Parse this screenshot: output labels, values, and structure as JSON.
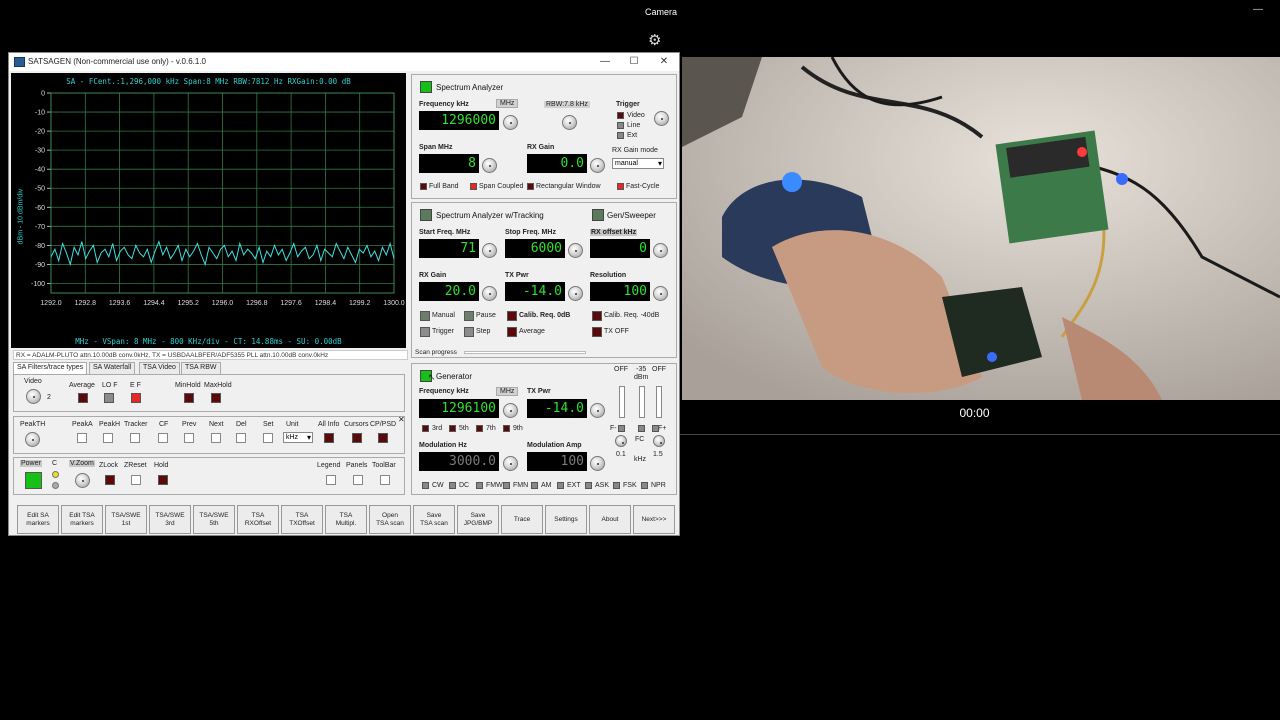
{
  "camera": {
    "title": "Camera",
    "minimize": "—",
    "time": "00:00"
  },
  "window": {
    "title": "SATSAGEN (Non-commercial use only) - v.0.6.1.0",
    "min": "—",
    "max": "☐",
    "close": "✕"
  },
  "plot": {
    "header": "SA - FCent.:1,296,000 kHz Span:8 MHz RBW:7812 Hz RXGain:0.00 dB",
    "footer": "MHz - VSpan: 8 MHz - 800 KHz/div - CT: 14.88ms - SU: 0.00dB",
    "ylabel": "dBm - 10 dBm/div"
  },
  "chart_data": {
    "type": "line",
    "title": "SA - FCent.:1,296,000 kHz Span:8 MHz RBW:7812 Hz RXGain:0.00 dB",
    "xlabel": "MHz - VSpan: 8 MHz - 800 KHz/div - CT: 14.88ms - SU: 0.00dB",
    "ylabel": "dBm - 10 dBm/div",
    "xlim": [
      1292.0,
      1300.0
    ],
    "ylim": [
      -105,
      0
    ],
    "grid": true,
    "x_ticks": [
      "1292.0",
      "1292.8",
      "1293.6",
      "1294.4",
      "1295.2",
      "1296.0",
      "1296.8",
      "1297.6",
      "1298.4",
      "1299.2",
      "1300.0"
    ],
    "y_ticks": [
      "0",
      "-10",
      "-20",
      "-30",
      "-40",
      "-50",
      "-60",
      "-70",
      "-80",
      "-90",
      "-100"
    ],
    "series": [
      {
        "values": [
          -86,
          -82,
          -88,
          -79,
          -84,
          -90,
          -81,
          -85,
          -78,
          -87,
          -83,
          -80,
          -89,
          -84,
          -82,
          -86,
          -79,
          -88,
          -83,
          -81,
          -85,
          -87,
          -80,
          -84,
          -86,
          -82,
          -89,
          -83,
          -78,
          -85,
          -81,
          -87,
          -84,
          -80,
          -88,
          -82,
          -86,
          -83,
          -79,
          -85,
          -90,
          -81,
          -84,
          -87,
          -82,
          -80,
          -86,
          -83,
          -88,
          -79,
          -85,
          -82,
          -84,
          -87,
          -81,
          -89,
          -83,
          -86,
          -80,
          -85,
          -82,
          -88,
          -84,
          -79,
          -86,
          -83,
          -81,
          -87,
          -85,
          -80,
          -88,
          -82,
          -84,
          -86,
          -79,
          -83,
          -87,
          -81,
          -85,
          -89,
          -82,
          -84,
          -80,
          -86,
          -83,
          -88,
          -81,
          -85,
          -79,
          -87
        ]
      }
    ]
  },
  "status_line": "RX = ADALM-PLUTO attn.10.00dB conv.0kHz, TX = USBDAALBFER/ADF5355 PLL attn.10.00dB conv.0kHz",
  "tabs": [
    "SA Filters/trace types",
    "SA Waterfall",
    "TSA Video",
    "TSA RBW"
  ],
  "filters": {
    "video": "Video",
    "video_val": "2",
    "average": "Average",
    "lof": "LO F",
    "ef": "E F",
    "minhold": "MinHold",
    "maxhold": "MaxHold"
  },
  "peaks": {
    "peakth": "PeakTH",
    "peaka": "PeakA",
    "peakh": "PeakH",
    "tracker": "Tracker",
    "cf": "CF",
    "prev": "Prev",
    "next": "Next",
    "del": "Del",
    "set": "Set",
    "unit": "Unit",
    "unit_val": "kHz",
    "allinfo": "All Info",
    "cursors": "Cursors",
    "cpsd": "CP/PSD",
    "close": "✕"
  },
  "power": {
    "power": "Power",
    "c": "C",
    "vzoom": "V.Zoom",
    "zlock": "ZLock",
    "zreset": "ZReset",
    "hold": "Hold",
    "legend": "Legend",
    "panels": "Panels",
    "toolbar": "ToolBar"
  },
  "sa": {
    "title": "Spectrum Analyzer",
    "freq_label": "Frequency kHz",
    "mhz": "MHz",
    "freq": "1296000",
    "rbw": "RBW:7.8 kHz",
    "trigger": "Trigger",
    "trig_video": "Video",
    "trig_line": "Line",
    "trig_ext": "Ext",
    "span_label": "Span MHz",
    "span": "8",
    "gain_label": "RX Gain",
    "gain": "0.0",
    "mode_label": "RX Gain mode",
    "mode": "manual",
    "fullband": "Full Band",
    "spancoupled": "Span Coupled",
    "rectwin": "Rectangular Window",
    "fastcycle": "Fast-Cycle"
  },
  "tsa": {
    "title": "Spectrum Analyzer w/Tracking",
    "gen_title": "Gen/Sweeper",
    "start_label": "Start Freq. MHz",
    "start": "71",
    "stop_label": "Stop Freq. MHz",
    "stop": "6000",
    "rxoff_label": "RX offset kHz",
    "rxoff": "0",
    "rxgain_label": "RX Gain",
    "rxgain": "20.0",
    "txpwr_label": "TX Pwr",
    "txpwr": "-14.0",
    "res_label": "Resolution",
    "res": "100",
    "manual": "Manual",
    "pause": "Pause",
    "calib0": "Calib. Req. 0dB",
    "calib40": "Calib. Req. -40dB",
    "trigger": "Trigger",
    "step": "Step",
    "average": "Average",
    "txoff": "TX OFF",
    "scan": "Scan progress"
  },
  "gen": {
    "title": "Generator",
    "freq_label": "Frequency kHz",
    "mhz": "MHz",
    "freq": "1296100",
    "txpwr_label": "TX Pwr",
    "txpwr": "-14.0",
    "h3": "3rd",
    "h5": "5th",
    "h7": "7th",
    "h9": "9th",
    "mod_label": "Modulation Hz",
    "mod": "3000.0",
    "amp_label": "Modulation Amp",
    "amp": "100",
    "off1": "OFF",
    "dbm": "-35\ndBm",
    "off2": "OFF",
    "fminus": "F-",
    "fc": "FC",
    "fplus": "F+",
    "v01": "0.1",
    "khz": "kHz",
    "v15": "1.5",
    "cw": "CW",
    "dc": "DC",
    "fmw": "FMW",
    "fmn": "FMN",
    "am": "AM",
    "ext": "EXT",
    "ask": "ASK",
    "fsk": "FSK",
    "npr": "NPR"
  },
  "buttons": [
    "Edit SA\nmarkers",
    "Edit TSA\nmarkers",
    "TSA/SWE\n1st",
    "TSA/SWE\n3rd",
    "TSA/SWE\n5th",
    "TSA\nRXOffset",
    "TSA\nTXOffset",
    "TSA\nMultipl.",
    "Open\nTSA scan",
    "Save\nTSA scan",
    "Save\nJPG/BMP",
    "Trace",
    "Settings",
    "About",
    "Next>>>"
  ]
}
